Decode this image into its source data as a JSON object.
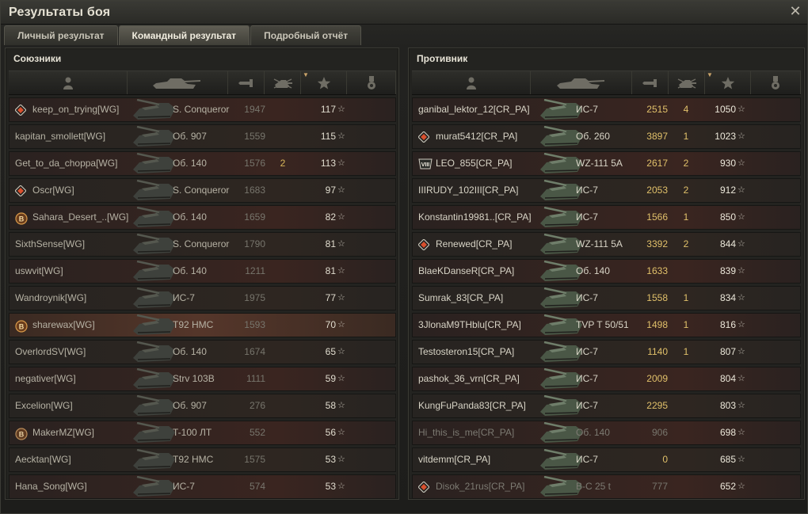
{
  "window": {
    "title": "Результаты боя"
  },
  "tabs": [
    {
      "label": "Личный результат",
      "active": false
    },
    {
      "label": "Командный результат",
      "active": true
    },
    {
      "label": "Подробный отчёт",
      "active": false
    }
  ],
  "colors": {
    "accent": "#c9a36a",
    "kills": "#e0c06a",
    "row_highlight": "#55362a"
  },
  "allies": {
    "title": "Союзники",
    "header_icons": [
      "player-icon",
      "vehicle-icon",
      "damage-icon",
      "kills-icon",
      "xp-star-icon",
      "medal-icon"
    ],
    "rows": [
      {
        "badge": "diamond-badge",
        "player": "keep_on_trying[WG]",
        "vehicle": "S. Conqueror",
        "damage": "1947",
        "kills": "",
        "xp": "117"
      },
      {
        "badge": "",
        "player": "kapitan_smollett[WG]",
        "vehicle": "Об. 907",
        "damage": "1559",
        "kills": "",
        "xp": "115"
      },
      {
        "badge": "",
        "player": "Get_to_da_choppa[WG]",
        "vehicle": "Об. 140",
        "damage": "1576",
        "kills": "2",
        "xp": "113"
      },
      {
        "badge": "diamond-badge",
        "player": "Oscr[WG]",
        "vehicle": "S. Conqueror",
        "damage": "1683",
        "kills": "",
        "xp": "97"
      },
      {
        "badge": "b-badge",
        "player": "Sahara_Desert_..[WG]",
        "vehicle": "Об. 140",
        "damage": "1659",
        "kills": "",
        "xp": "82"
      },
      {
        "badge": "",
        "player": "SixthSense[WG]",
        "vehicle": "S. Conqueror",
        "damage": "1790",
        "kills": "",
        "xp": "81"
      },
      {
        "badge": "",
        "player": "uswvit[WG]",
        "vehicle": "Об. 140",
        "damage": "1211",
        "kills": "",
        "xp": "81"
      },
      {
        "badge": "",
        "player": "Wandroynik[WG]",
        "vehicle": "ИС-7",
        "damage": "1975",
        "kills": "",
        "xp": "77"
      },
      {
        "badge": "b-badge",
        "player": "sharewax[WG]",
        "vehicle": "T92 HMC",
        "damage": "1593",
        "kills": "",
        "xp": "70",
        "highlight": true
      },
      {
        "badge": "",
        "player": "OverlordSV[WG]",
        "vehicle": "Об. 140",
        "damage": "1674",
        "kills": "",
        "xp": "65"
      },
      {
        "badge": "",
        "player": "negativer[WG]",
        "vehicle": "Strv 103B",
        "damage": "1111",
        "kills": "",
        "xp": "59"
      },
      {
        "badge": "",
        "player": "Excelion[WG]",
        "vehicle": "Об. 907",
        "damage": "276",
        "kills": "",
        "xp": "58"
      },
      {
        "badge": "b2-badge",
        "player": "MakerMZ[WG]",
        "vehicle": "T-100 ЛТ",
        "damage": "552",
        "kills": "",
        "xp": "56"
      },
      {
        "badge": "",
        "player": "Aecktan[WG]",
        "vehicle": "T92 HMC",
        "damage": "1575",
        "kills": "",
        "xp": "53"
      },
      {
        "badge": "",
        "player": "Hana_Song[WG]",
        "vehicle": "ИС-7",
        "damage": "574",
        "kills": "",
        "xp": "53"
      }
    ]
  },
  "enemies": {
    "title": "Противник",
    "header_icons": [
      "player-icon",
      "vehicle-icon",
      "damage-icon",
      "kills-icon",
      "xp-star-icon",
      "medal-icon"
    ],
    "rows": [
      {
        "badge": "",
        "player": "ganibal_lektor_12[CR_PA]",
        "vehicle": "ИС-7",
        "damage": "2515",
        "kills": "4",
        "xp": "1050"
      },
      {
        "badge": "diamond-badge",
        "player": "murat5412[CR_PA]",
        "vehicle": "Об. 260",
        "damage": "3897",
        "kills": "1",
        "xp": "1023"
      },
      {
        "badge": "viii-badge",
        "player": "LEO_855[CR_PA]",
        "vehicle": "WZ-111 5A",
        "damage": "2617",
        "kills": "2",
        "xp": "930"
      },
      {
        "badge": "",
        "player": "IIIRUDY_102III[CR_PA]",
        "vehicle": "ИС-7",
        "damage": "2053",
        "kills": "2",
        "xp": "912"
      },
      {
        "badge": "",
        "player": "Konstantin19981..[CR_PA]",
        "vehicle": "ИС-7",
        "damage": "1566",
        "kills": "1",
        "xp": "850"
      },
      {
        "badge": "diamond-badge",
        "player": "Renewed[CR_PA]",
        "vehicle": "WZ-111 5A",
        "damage": "3392",
        "kills": "2",
        "xp": "844"
      },
      {
        "badge": "",
        "player": "BlaeKDanseR[CR_PA]",
        "vehicle": "Об. 140",
        "damage": "1633",
        "kills": "",
        "xp": "839"
      },
      {
        "badge": "",
        "player": "Sumrak_83[CR_PA]",
        "vehicle": "ИС-7",
        "damage": "1558",
        "kills": "1",
        "xp": "834"
      },
      {
        "badge": "",
        "player": "3JlonaM9THblu[CR_PA]",
        "vehicle": "TVP T 50/51",
        "damage": "1498",
        "kills": "1",
        "xp": "816"
      },
      {
        "badge": "",
        "player": "Testosteron15[CR_PA]",
        "vehicle": "ИС-7",
        "damage": "1140",
        "kills": "1",
        "xp": "807"
      },
      {
        "badge": "",
        "player": "pashok_36_vrn[CR_PA]",
        "vehicle": "ИС-7",
        "damage": "2009",
        "kills": "",
        "xp": "804"
      },
      {
        "badge": "",
        "player": "KungFuPanda83[CR_PA]",
        "vehicle": "ИС-7",
        "damage": "2295",
        "kills": "",
        "xp": "803"
      },
      {
        "badge": "",
        "player": "Hi_this_is_me[CR_PA]",
        "vehicle": "Об. 140",
        "damage": "906",
        "kills": "",
        "xp": "698",
        "dead": true
      },
      {
        "badge": "",
        "player": "vitdemm[CR_PA]",
        "vehicle": "ИС-7",
        "damage": "0",
        "kills": "",
        "xp": "685"
      },
      {
        "badge": "diamond-badge",
        "player": "Disok_21rus[CR_PA]",
        "vehicle": "B-C 25 t",
        "damage": "777",
        "kills": "",
        "xp": "652",
        "dead": true
      }
    ]
  }
}
